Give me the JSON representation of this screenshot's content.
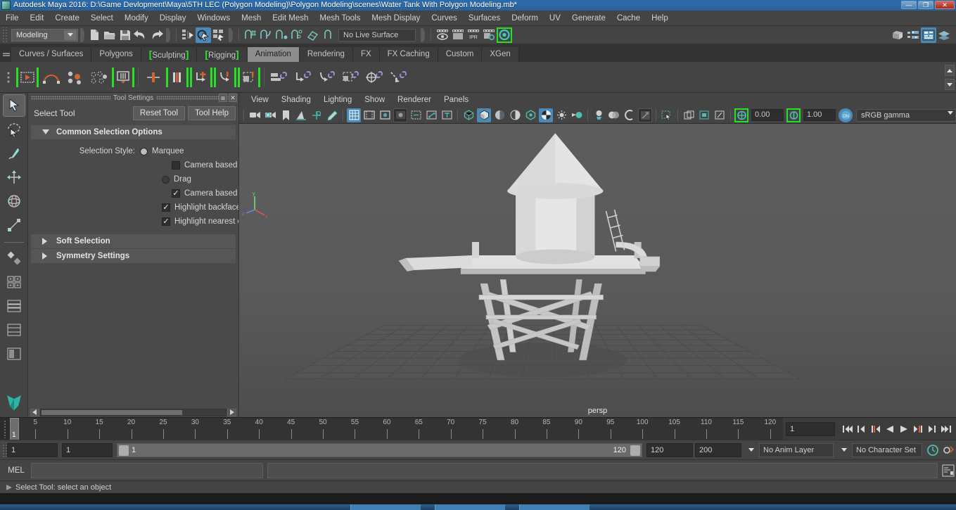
{
  "titlebar": {
    "app_title": "Autodesk Maya 2016: D:\\Game Devlopment\\Maya\\5TH LEC (Polygon Modeling)\\Polygon Modeling\\scenes\\Water Tank With Polygon Modeling.mb*",
    "minimize": "—",
    "maximize": "❐",
    "close": "✕"
  },
  "menubar": {
    "items": [
      {
        "label": "File"
      },
      {
        "label": "Edit"
      },
      {
        "label": "Create"
      },
      {
        "label": "Select"
      },
      {
        "label": "Modify"
      },
      {
        "label": "Display"
      },
      {
        "label": "Windows"
      },
      {
        "label": "Mesh"
      },
      {
        "label": "Edit Mesh"
      },
      {
        "label": "Mesh Tools"
      },
      {
        "label": "Mesh Display"
      },
      {
        "label": "Curves"
      },
      {
        "label": "Surfaces"
      },
      {
        "label": "Deform"
      },
      {
        "label": "UV"
      },
      {
        "label": "Generate"
      },
      {
        "label": "Cache"
      },
      {
        "label": "Help"
      }
    ]
  },
  "statusline": {
    "menu_set": "Modeling",
    "live_surface": "No Live Surface",
    "icons": [
      "new-scene-icon",
      "open-scene-icon",
      "save-scene-icon",
      "undo-icon",
      "redo-icon",
      "select-hierarchy-icon",
      "select-object-icon",
      "select-component-icon",
      "snap-grid-icon",
      "snap-curve-icon",
      "snap-point-icon",
      "snap-projected-center-icon",
      "snap-view-plane-icon",
      "make-live-icon",
      "render-current-frame-icon",
      "render-sequence-icon",
      "ipr-render-icon",
      "render-settings-icon",
      "hypershade-icon",
      "show-hide-editors-icon",
      "attribute-editor-icon",
      "channel-box-icon",
      "layer-editor-icon"
    ]
  },
  "shelf": {
    "tabs": [
      {
        "label": "Curves / Surfaces",
        "selected": false,
        "bracket": false
      },
      {
        "label": "Polygons",
        "selected": false,
        "bracket": false
      },
      {
        "label": "Sculpting",
        "selected": false,
        "bracket": true
      },
      {
        "label": "Rigging",
        "selected": false,
        "bracket": true
      },
      {
        "label": "Animation",
        "selected": true,
        "bracket": false
      },
      {
        "label": "Rendering",
        "selected": false,
        "bracket": false
      },
      {
        "label": "FX",
        "selected": false,
        "bracket": false
      },
      {
        "label": "FX Caching",
        "selected": false,
        "bracket": false
      },
      {
        "label": "Custom",
        "selected": false,
        "bracket": false
      },
      {
        "label": "XGen",
        "selected": false,
        "bracket": false
      }
    ],
    "buttons": [
      {
        "name": "playblast-icon",
        "bracket": true
      },
      {
        "name": "motion-trail-icon",
        "bracket": false
      },
      {
        "name": "set-key-icon",
        "bracket": false
      },
      {
        "name": "set-breakdown-key-icon",
        "bracket": false
      },
      {
        "name": "bake-animation-icon",
        "bracket": true
      },
      {
        "name": "set-key-translate-icon",
        "bracket": false
      },
      {
        "name": "set-key-rotate-icon",
        "bracket": true
      },
      {
        "name": "ik-handle-icon",
        "bracket": true
      },
      {
        "name": "ik-spline-icon",
        "bracket": true
      },
      {
        "name": "constrain-selection-icon",
        "bracket": true
      },
      {
        "name": "parent-constraint-icon",
        "bracket": false
      },
      {
        "name": "point-constraint-icon",
        "bracket": false
      },
      {
        "name": "orient-constraint-icon",
        "bracket": false
      },
      {
        "name": "scale-constraint-icon",
        "bracket": false
      },
      {
        "name": "aim-constraint-icon",
        "bracket": false
      },
      {
        "name": "pole-vector-constraint-icon",
        "bracket": false
      }
    ]
  },
  "toolbox": {
    "items": [
      {
        "name": "select-tool",
        "selected": true
      },
      {
        "name": "lasso-select-tool",
        "selected": false
      },
      {
        "name": "paint-select-tool",
        "selected": false
      },
      {
        "name": "move-tool",
        "selected": false
      },
      {
        "name": "rotate-tool",
        "selected": false
      },
      {
        "name": "scale-tool",
        "selected": false
      },
      {
        "name": "last-tool-used",
        "selected": false
      },
      {
        "name": "single-perspective-layout",
        "selected": false
      },
      {
        "name": "four-view-layout",
        "selected": false
      },
      {
        "name": "persp-outliner-layout",
        "selected": false
      },
      {
        "name": "persp-graph-layout",
        "selected": false
      },
      {
        "name": "maya-logo",
        "selected": false
      }
    ]
  },
  "toolsettings": {
    "panel_title": "Tool Settings",
    "tool_name": "Select Tool",
    "reset_label": "Reset Tool",
    "help_label": "Tool Help",
    "sections": [
      {
        "title": "Common Selection Options",
        "expanded": true
      },
      {
        "title": "Soft Selection",
        "expanded": false
      },
      {
        "title": "Symmetry Settings",
        "expanded": false
      }
    ],
    "selection_style_label": "Selection Style:",
    "options": [
      {
        "label": "Marquee",
        "type": "radio",
        "checked": true
      },
      {
        "label": "Camera based selecti",
        "type": "checkbox",
        "checked": false
      },
      {
        "label": "Drag",
        "type": "radio",
        "checked": false
      },
      {
        "label": "Camera based paint s",
        "type": "checkbox",
        "checked": true
      },
      {
        "label": "Highlight backfaces",
        "type": "checkbox",
        "checked": true
      },
      {
        "label": "Highlight nearest compo",
        "type": "checkbox",
        "checked": true
      }
    ]
  },
  "viewport": {
    "menu": [
      "View",
      "Shading",
      "Lighting",
      "Show",
      "Renderer",
      "Panels"
    ],
    "camera_label": "persp",
    "exposure_value": "0.00",
    "gamma_value": "1.00",
    "color_management": "sRGB gamma",
    "toolbar_icons": [
      "select-camera-icon",
      "camera-attributes-icon",
      "bookmark-icon",
      "image-plane-icon",
      "two-d-pan-zoom-icon",
      "grease-pencil-icon",
      "grid-toggle-icon",
      "film-gate-icon",
      "resolution-gate-icon",
      "gate-mask-icon",
      "film-origin-icon",
      "xray-joints-icon",
      "texture-toggle-icon",
      "wireframe-icon",
      "smooth-shade-all-icon",
      "smooth-shade-textured-icon",
      "shadows-icon",
      "screen-space-ao-icon",
      "motion-blur-icon",
      "multisample-icon",
      "lights-icon",
      "default-light-icon",
      "all-lights-icon",
      "isolate-select-icon",
      "x-ray-icon",
      "xray-active-components-icon",
      "exposure-icon",
      "gamma-icon",
      "color-management-icon"
    ]
  },
  "timeline": {
    "ticks": [
      5,
      10,
      15,
      20,
      25,
      30,
      35,
      40,
      45,
      50,
      55,
      60,
      65,
      70,
      75,
      80,
      85,
      90,
      95,
      100,
      105,
      110,
      115,
      120
    ],
    "current_frame_marker": "1",
    "current_frame_field": "1",
    "playback_buttons": [
      "go-to-start-icon",
      "step-back-frame-icon",
      "step-back-key-icon",
      "play-backwards-icon",
      "play-forwards-icon",
      "step-forward-key-icon",
      "step-forward-frame-icon",
      "go-to-end-icon"
    ]
  },
  "rangeslider": {
    "start_field": "1",
    "playback_start_field": "1",
    "range_start": "1",
    "range_end": "120",
    "playback_end_field": "120",
    "anim_end_field": "200",
    "anim_layer": "No Anim Layer",
    "character_set": "No Character Set",
    "icons": [
      "auto-keyframe-icon",
      "animation-preferences-icon"
    ]
  },
  "commandline": {
    "mel_label": "MEL",
    "input_value": "",
    "output_value": "",
    "script-editor-icon": "script-editor-icon"
  },
  "helpline": {
    "text": "Select Tool: select an object"
  },
  "colors": {
    "accent_green": "#25e025",
    "accent_blue": "#4a89b8",
    "accent_orange": "#cc6633",
    "panel_bg": "#444444",
    "viewport_bg": "#5a5a5a"
  }
}
